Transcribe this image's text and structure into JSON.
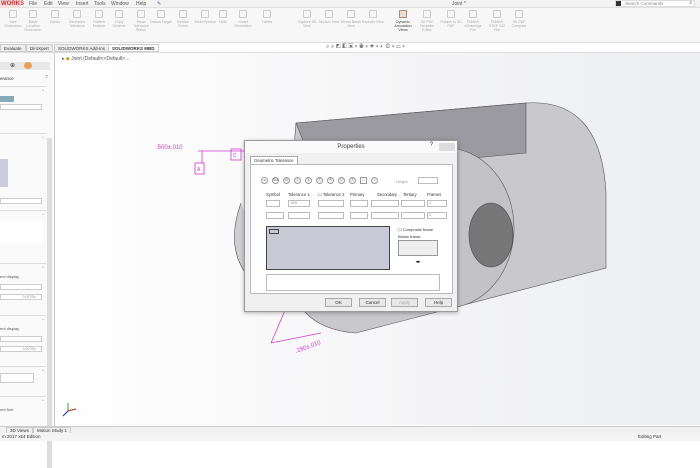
{
  "app": {
    "logo": "WORKS",
    "doc_title": "Joint *",
    "search_placeholder": "Search Commands"
  },
  "menu": [
    "File",
    "Edit",
    "View",
    "Insert",
    "Tools",
    "Window",
    "Help"
  ],
  "ribbon": [
    {
      "label": "Size Dimension",
      "on": false
    },
    {
      "label": "Basic Location Dimension",
      "on": false
    },
    {
      "label": "Datum",
      "on": false
    },
    {
      "label": "Geometric Tolerance",
      "on": false
    },
    {
      "label": "Pattern Feature",
      "on": false
    },
    {
      "label": "Copy Scheme",
      "on": false
    },
    {
      "label": "Show Tolerance Status",
      "on": false
    },
    {
      "label": "Datum Target",
      "on": false
    },
    {
      "label": "Surface Finish",
      "on": false
    },
    {
      "label": "Weld Symbol",
      "on": false
    },
    {
      "label": "Note",
      "on": false
    },
    {
      "label": "Smart Dimension",
      "on": false
    },
    {
      "label": "Tables",
      "on": false
    },
    {
      "label": "Capture 3D View",
      "on": false
    },
    {
      "label": "Section View",
      "on": false
    },
    {
      "label": "Model Break View",
      "on": false
    },
    {
      "label": "Explode View",
      "on": false
    },
    {
      "label": "Dynamic Annotation Views",
      "on": true
    },
    {
      "label": "3D PDF Template Editor",
      "on": false
    },
    {
      "label": "Publish to 3D PDF",
      "on": false
    },
    {
      "label": "Publish eDrawings File",
      "on": false
    },
    {
      "label": "Publish STEP 242 File",
      "on": false
    },
    {
      "label": "3D PDF Compare",
      "on": false
    }
  ],
  "tabs": [
    "Evaluate",
    "DimXpert",
    "SOLIDWORKS Add-Ins",
    "SOLIDWORKS MBD"
  ],
  "active_tab": "SOLIDWORKS MBD",
  "tree": {
    "item": "Joint (Default<<Default>..."
  },
  "left_panel": {
    "title": "erance",
    "sec1": "ent display",
    "sec2": "ent display",
    "val1": "0.0070in",
    "val2": "0.0070in",
    "font": "ent font"
  },
  "annotations": {
    "dim1": ".500±.010",
    "datum": "A",
    "dim2": ".250±.010",
    "box": "C"
  },
  "dialog": {
    "title": "Properties",
    "help_glyph": "?",
    "tab": "Geometric Tolerance",
    "symbols": [
      "⌀",
      "SM",
      "Ⓜ",
      "Ⓛ",
      "Ⓢ",
      "Ⓣ",
      "Ⓟ",
      "Ⓤ",
      "Ⓕ",
      "□",
      "Ⓘ"
    ],
    "height_label": "Height",
    "headers": {
      "symbol": "Symbol",
      "tol1": "Tolerance 1",
      "tol2": "Tolerance 2",
      "primary": "Primary",
      "secondary": "Secondary",
      "tertiary": "Tertiary",
      "frames": "Frames"
    },
    "tol1_value": ".020",
    "frame1": "1",
    "frame2": "2",
    "composite": "Composite frame",
    "below": "Below frame:",
    "ok": "OK",
    "cancel": "Cancel",
    "apply": "Apply",
    "help": "Help"
  },
  "bottom_tabs": [
    "3D Views",
    "Motion Study 1"
  ],
  "status": {
    "left": "m 2017 x64 Edition",
    "right": "Editing Part"
  },
  "colors": {
    "annotation": "#d23ad2",
    "dialog_bg": "#f0f0f0",
    "preview": "#c7cad6"
  }
}
